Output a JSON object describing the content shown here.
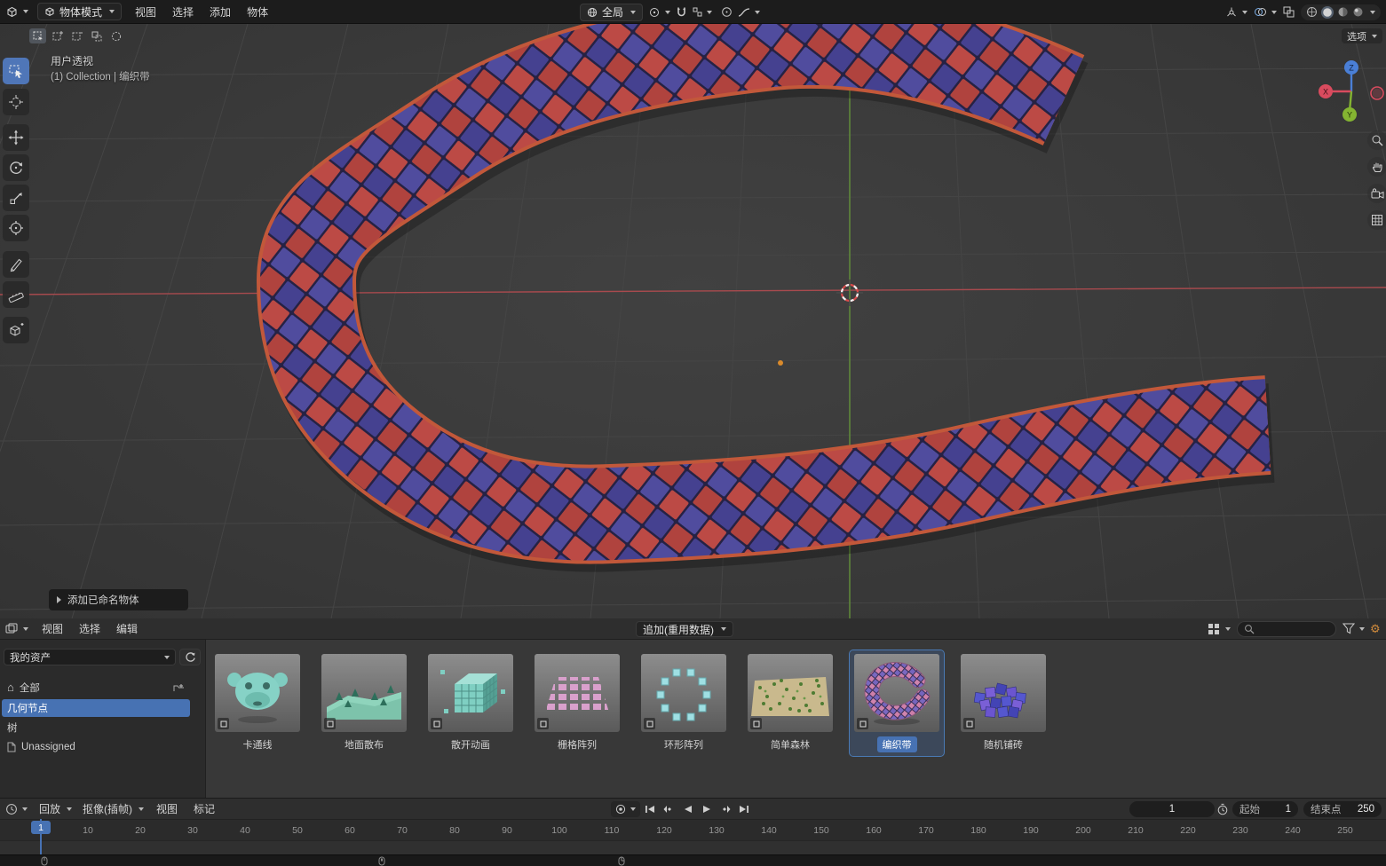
{
  "topbar": {
    "mode_label": "物体模式",
    "menus": [
      "视图",
      "选择",
      "添加",
      "物体"
    ],
    "orientation_label": "全局",
    "options_label": "选项"
  },
  "viewport": {
    "view_name": "用户透视",
    "context_label": "(1) Collection | 编织带",
    "add_named_object_label": "添加已命名物体"
  },
  "asset_browser": {
    "menus": [
      "视图",
      "选择",
      "编辑"
    ],
    "import_method_label": "追加(重用数据)",
    "source_label": "我的资产",
    "catalogs": [
      {
        "label": "全部"
      },
      {
        "label": "几何节点"
      },
      {
        "label": "树"
      },
      {
        "label": "Unassigned"
      }
    ],
    "assets": [
      {
        "label": "卡通线"
      },
      {
        "label": "地面散布"
      },
      {
        "label": "散开动画"
      },
      {
        "label": "栅格阵列"
      },
      {
        "label": "环形阵列"
      },
      {
        "label": "简单森林"
      },
      {
        "label": "编织带"
      },
      {
        "label": "随机铺砖"
      }
    ]
  },
  "timeline": {
    "playback_label": "回放",
    "keying_label": "抠像(插帧)",
    "view_label": "视图",
    "marker_label": "标记",
    "current_frame": "1",
    "start_label": "起始",
    "start_value": "1",
    "end_label": "结束点",
    "end_value": "250",
    "playhead_frame": "1",
    "ruler_ticks": [
      "10",
      "20",
      "30",
      "40",
      "50",
      "60",
      "70",
      "80",
      "90",
      "100",
      "110",
      "120",
      "130",
      "140",
      "150",
      "160",
      "170",
      "180",
      "190",
      "200",
      "210",
      "220",
      "230",
      "240",
      "250"
    ]
  },
  "icons": {
    "gear": "⚙",
    "home": "⌂",
    "axis_x": "X",
    "axis_y": "Y",
    "axis_z": "Z"
  },
  "colors": {
    "accent": "#4772b3",
    "rope_red": "#b84743",
    "rope_blue": "#4e4a9c",
    "outline_orange": "#c2583a"
  }
}
